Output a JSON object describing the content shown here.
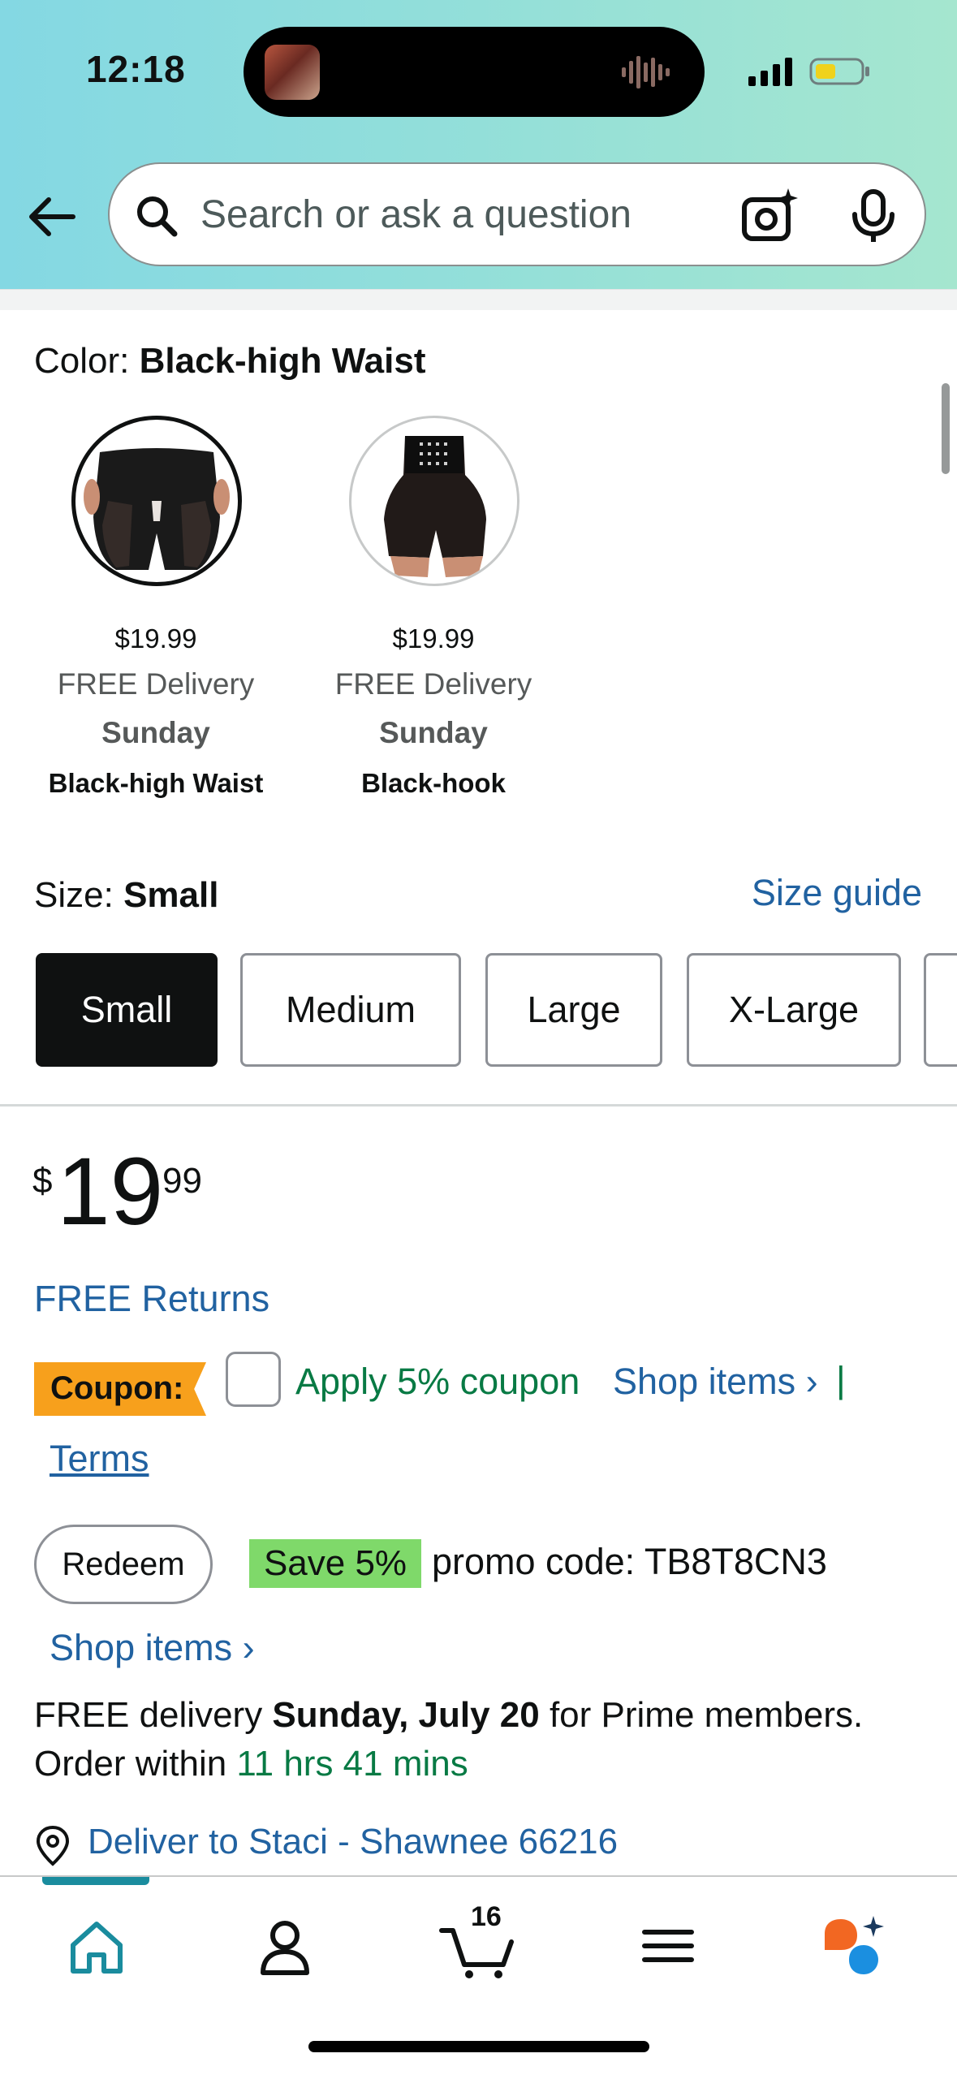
{
  "status_bar": {
    "time": "12:18"
  },
  "search": {
    "placeholder": "Search or ask a question"
  },
  "color": {
    "label": "Color:",
    "selected": "Black-high Waist",
    "swatches": [
      {
        "price": "$19.99",
        "delivery": "FREE Delivery",
        "day": "Sunday",
        "name": "Black-high Waist",
        "selected": true
      },
      {
        "price": "$19.99",
        "delivery": "FREE Delivery",
        "day": "Sunday",
        "name": "Black-hook",
        "selected": false
      }
    ]
  },
  "size": {
    "label": "Size:",
    "selected": "Small",
    "guide": "Size guide",
    "options": [
      "Small",
      "Medium",
      "Large",
      "X-Large"
    ]
  },
  "price": {
    "symbol": "$",
    "whole": "19",
    "fraction": "99"
  },
  "free_returns": "FREE Returns",
  "coupon": {
    "badge": "Coupon:",
    "apply": "Apply 5% coupon",
    "shop_items": "Shop items ›",
    "separator": "|",
    "terms": "Terms"
  },
  "promo": {
    "redeem": "Redeem",
    "save": "Save 5%",
    "text": "promo code: TB8T8CN3",
    "shop_items": "Shop items ›"
  },
  "delivery": {
    "prefix": "FREE delivery ",
    "date": "Sunday, July 20",
    "suffix": " for Prime members.",
    "order_within": "Order within ",
    "countdown": "11 hrs 41 mins",
    "deliver_to": "Deliver to Staci - Shawnee 66216"
  },
  "nav": {
    "cart_count": "16"
  },
  "colors": {
    "link": "#2162a1",
    "green": "#087a44",
    "coupon": "#f7a01c",
    "save_badge": "#7fd96a",
    "teal": "#1a8c9e"
  }
}
